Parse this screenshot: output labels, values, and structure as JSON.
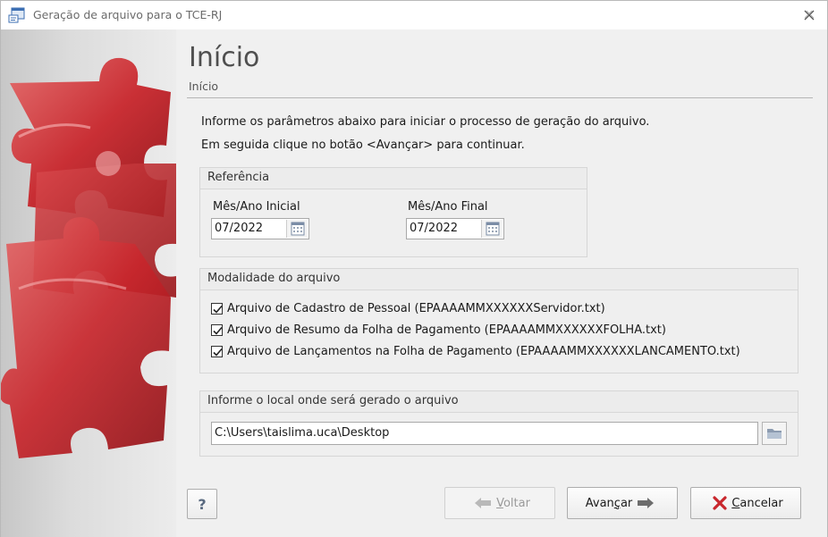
{
  "window": {
    "title": "Geração de arquivo para o TCE-RJ",
    "close_glyph": "x"
  },
  "header": {
    "title": "Início",
    "subtitle": "Início"
  },
  "intro": {
    "line1": "Informe os parâmetros abaixo para iniciar o processo de geração do arquivo.",
    "line2": "Em seguida clique no botão <Avançar> para continuar."
  },
  "referencia": {
    "title": "Referência",
    "start_label": "Mês/Ano Inicial",
    "start_value": "07/2022",
    "end_label": "Mês/Ano Final",
    "end_value": "07/2022"
  },
  "modalidade": {
    "title": "Modalidade do arquivo",
    "options": [
      {
        "label": "Arquivo de Cadastro de Pessoal (EPAAAAMMXXXXXXServidor.txt)",
        "checked": true
      },
      {
        "label": "Arquivo de Resumo da Folha de Pagamento (EPAAAAMMXXXXXXFOLHA.txt)",
        "checked": true
      },
      {
        "label": "Arquivo de Lançamentos na Folha de Pagamento (EPAAAAMMXXXXXXLANCAMENTO.txt)",
        "checked": true
      }
    ]
  },
  "local": {
    "title": "Informe o local onde será gerado o arquivo",
    "path": "C:\\Users\\taislima.uca\\Desktop"
  },
  "buttons": {
    "help": "?",
    "back_underline": "V",
    "back_rest": "oltar",
    "next_pre": "Avan",
    "next_underline": "ç",
    "next_rest": "ar",
    "cancel_underline": "C",
    "cancel_rest": "ancelar"
  },
  "icons": {
    "app": "app-window-icon",
    "calendar": "calendar-icon",
    "folder": "folder-open-icon",
    "back": "arrow-left-icon",
    "next": "arrow-right-icon",
    "cancel": "x-cancel-icon"
  },
  "colors": {
    "accent_red": "#c8262c",
    "arrow_gray": "#6d6d6d",
    "text": "#1a1a1a",
    "disabled": "#9a9a9a"
  }
}
